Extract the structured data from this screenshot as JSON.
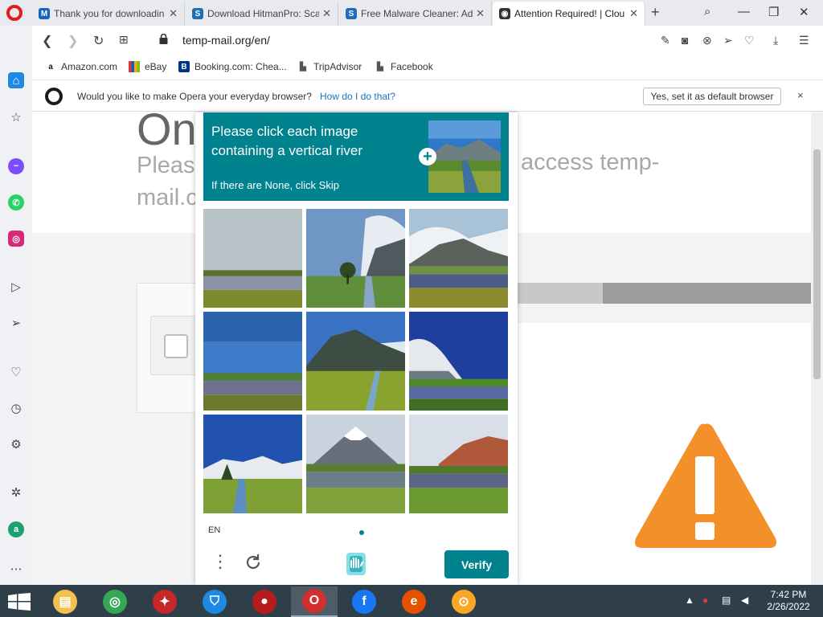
{
  "browser": {
    "tabs": [
      {
        "title": "Thank you for downloadin",
        "favicon": "malwarebytes-icon",
        "color": "#1565c0",
        "glyph": "M"
      },
      {
        "title": "Download HitmanPro: Sca",
        "favicon": "s-site-icon",
        "color": "#1e6fb8",
        "glyph": "S"
      },
      {
        "title": "Free Malware Cleaner: Ad",
        "favicon": "s-site-icon",
        "color": "#1e6fb8",
        "glyph": "S"
      },
      {
        "title": "Attention Required! | Clou",
        "favicon": "globe-icon",
        "color": "#333333",
        "glyph": "◉"
      }
    ],
    "active_tab_index": 3,
    "url": "temp-mail.org/en/",
    "bookmarks": [
      {
        "label": "Amazon.com",
        "icon": "amazon-icon"
      },
      {
        "label": "eBay",
        "icon": "ebay-icon"
      },
      {
        "label": "Booking.com: Chea...",
        "icon": "booking-icon"
      },
      {
        "label": "TripAdvisor",
        "icon": "page-icon"
      },
      {
        "label": "Facebook",
        "icon": "page-icon"
      }
    ],
    "notification": {
      "message": "Would you like to make Opera your everyday browser?",
      "link": "How do I do that?",
      "button": "Yes, set it as default browser",
      "close": "×"
    }
  },
  "page": {
    "title_fragment": "On",
    "subtitle_left_line1": "Please",
    "subtitle_left_line2": "mail.c",
    "subtitle_right": "access temp-"
  },
  "captcha": {
    "prompt": "Please click each image containing a vertical river",
    "subprompt": "If there are None, click Skip",
    "language": "EN",
    "verify_label": "Verify",
    "menu_label": "⋮",
    "tiles": [
      {
        "scene": "wetland-pond",
        "selected": false
      },
      {
        "scene": "tree-vertical-stream",
        "selected": false
      },
      {
        "scene": "mountain-pond",
        "selected": false
      },
      {
        "scene": "wetland-pond-blue-sky",
        "selected": false
      },
      {
        "scene": "mountain-vertical-stream",
        "selected": false
      },
      {
        "scene": "snowy-mountain-pond",
        "selected": false
      },
      {
        "scene": "snowy-mountain-vertical-stream",
        "selected": false
      },
      {
        "scene": "volcano-pond",
        "selected": false
      },
      {
        "scene": "red-mountain-pond",
        "selected": false
      }
    ]
  },
  "taskbar": {
    "apps": [
      {
        "name": "file-explorer-icon",
        "color": "#f2c14e",
        "glyph": "▤"
      },
      {
        "name": "chrome-icon",
        "color": "#34a853",
        "glyph": "◎"
      },
      {
        "name": "security-app-icon",
        "color": "#c62828",
        "glyph": "✦"
      },
      {
        "name": "vpn-shield-icon",
        "color": "#1e88e5",
        "glyph": "⛉"
      },
      {
        "name": "screen-recorder-icon",
        "color": "#b71c1c",
        "glyph": "●"
      },
      {
        "name": "opera-icon",
        "color": "#d32f2f",
        "glyph": "O"
      },
      {
        "name": "facebook-icon",
        "color": "#1877f2",
        "glyph": "f"
      },
      {
        "name": "antivirus-icon",
        "color": "#e65100",
        "glyph": "e"
      },
      {
        "name": "privacy-app-icon",
        "color": "#f9a825",
        "glyph": "⊙"
      }
    ],
    "active_app_index": 5,
    "time": "7:42 PM",
    "date": "2/26/2022"
  },
  "colors": {
    "captcha_teal": "#00838f",
    "warning_orange": "#f4902a",
    "opera_red": "#e21b1b"
  }
}
